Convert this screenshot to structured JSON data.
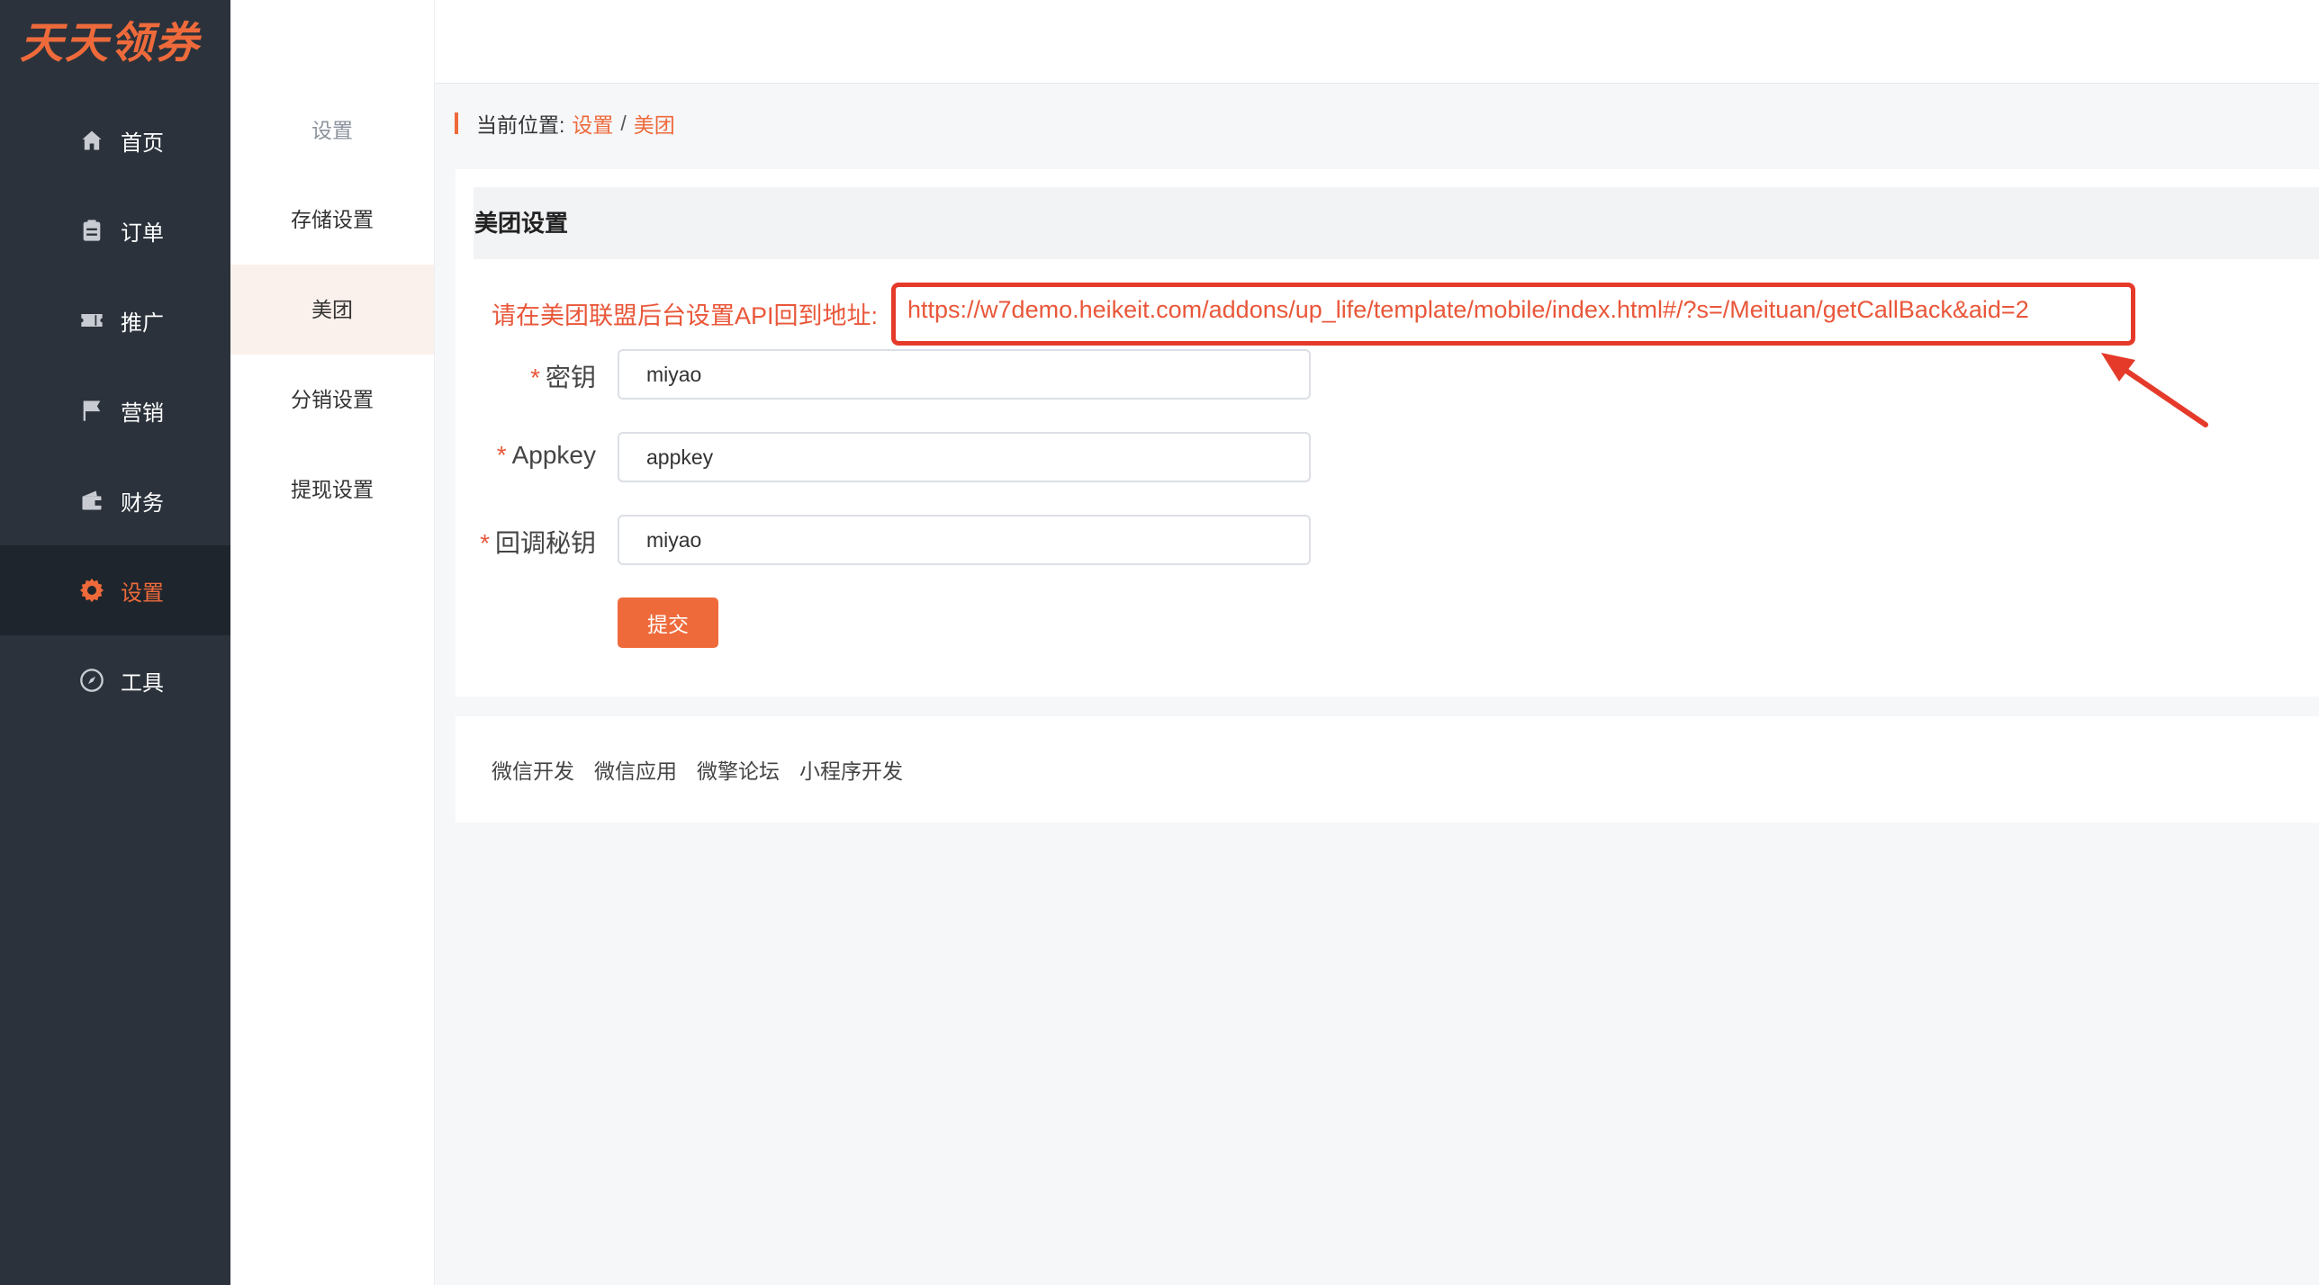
{
  "app": {
    "logo_text": "天天领券",
    "logo_color": "#ee6a3b",
    "accent_color": "#ee6a3b"
  },
  "sidebar": {
    "items": [
      {
        "label": "首页",
        "icon": "home-icon"
      },
      {
        "label": "订单",
        "icon": "clipboard-icon"
      },
      {
        "label": "推广",
        "icon": "ticket-icon"
      },
      {
        "label": "营销",
        "icon": "flag-icon"
      },
      {
        "label": "财务",
        "icon": "wallet-icon"
      },
      {
        "label": "设置",
        "icon": "gear-icon",
        "active": true
      },
      {
        "label": "工具",
        "icon": "compass-icon"
      }
    ]
  },
  "submenu": {
    "title": "设置",
    "items": [
      {
        "label": "存储设置"
      },
      {
        "label": "美团",
        "active": true
      },
      {
        "label": "分销设置"
      },
      {
        "label": "提现设置"
      }
    ]
  },
  "breadcrumb": {
    "prefix": "当前位置:",
    "items": [
      "设置",
      "美团"
    ],
    "separator": "/"
  },
  "form": {
    "title": "美团设置",
    "notice_text": "请在美团联盟后台设置API回到地址:",
    "callback_url": "https://w7demo.heikeit.com/addons/up_life/template/mobile/index.html#/?s=/Meituan/getCallBack&aid=2",
    "required_mark": "*",
    "fields": [
      {
        "label": "密钥",
        "value": "miyao"
      },
      {
        "label": "Appkey",
        "value": "appkey"
      },
      {
        "label": "回调秘钥",
        "value": "miyao"
      }
    ],
    "submit_label": "提交"
  },
  "footer": {
    "links": [
      "微信开发",
      "微信应用",
      "微擎论坛",
      "小程序开发"
    ]
  },
  "annotation": {
    "highlight_color": "#e53a2a"
  }
}
